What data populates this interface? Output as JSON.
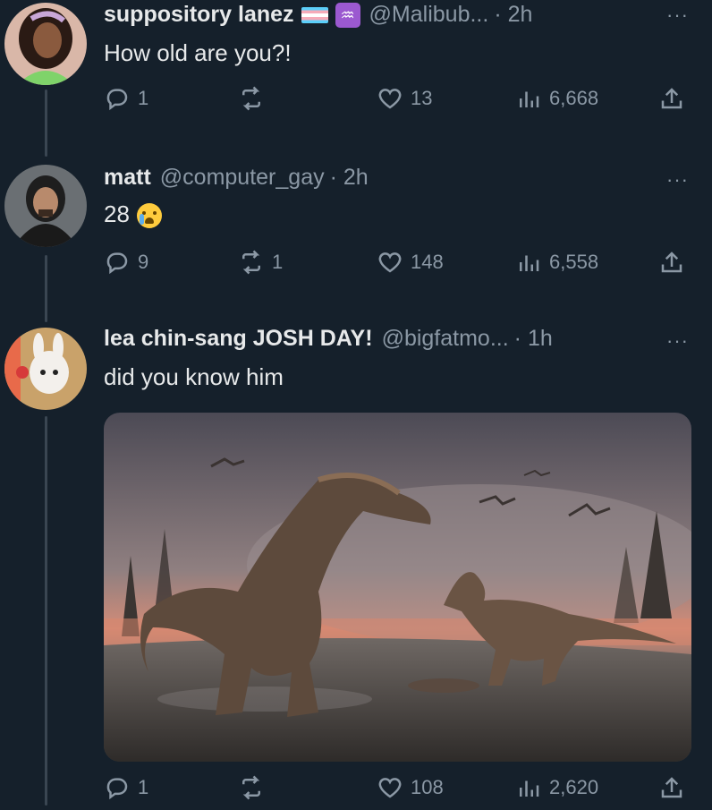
{
  "tweets": [
    {
      "name": "suppository lanez",
      "handle": "@Malibub...",
      "time": "· 2h",
      "text": "How old are you?!",
      "badge_icons": [
        "trans-flag-icon",
        "aquarius-icon"
      ],
      "aquarius_glyph": "♒",
      "stats": {
        "replies": "1",
        "retweets": "",
        "likes": "13",
        "views": "6,668"
      }
    },
    {
      "name": "matt",
      "handle": "@computer_gay",
      "time": "· 2h",
      "text": "28",
      "emoji": "crying-face-icon",
      "stats": {
        "replies": "9",
        "retweets": "1",
        "likes": "148",
        "views": "6,558"
      }
    },
    {
      "name": "lea chin-sang JOSH DAY!",
      "handle": "@bigfatmo...",
      "time": "· 1h",
      "text": "did you know him",
      "media": "dinosaur-illustration-image",
      "stats": {
        "replies": "1",
        "retweets": "",
        "likes": "108",
        "views": "2,620"
      }
    }
  ],
  "more_glyph": "···",
  "colors": {
    "background": "#15202b",
    "text": "#e7e9ea",
    "muted": "#8b98a5",
    "thread_line": "#3a4652"
  }
}
